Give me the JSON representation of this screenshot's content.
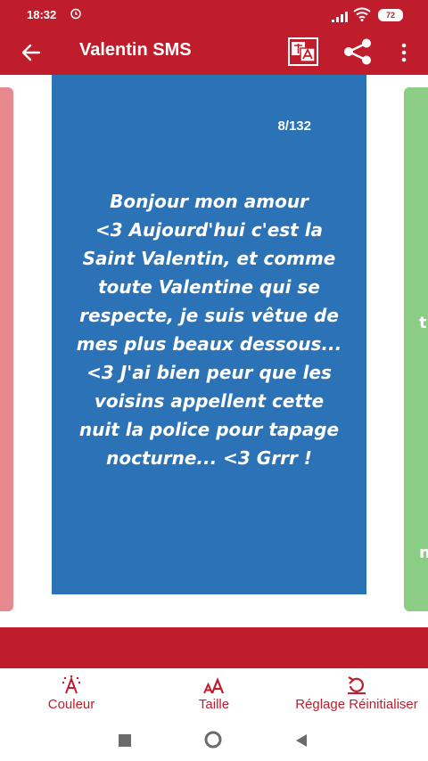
{
  "status": {
    "time": "18:32",
    "battery": "72"
  },
  "appbar": {
    "title": "Valentin SMS"
  },
  "card": {
    "counter": "8/132",
    "lines": [
      "Bonjour mon amour",
      "<3 Aujourd'hui c'est la",
      "Saint Valentin, et comme",
      "toute Valentine qui se",
      "respecte, je suis vêtue de",
      "mes plus beaux dessous...",
      "<3 J'ai bien peur que les",
      "voisins appellent cette",
      "nuit la police pour tapage",
      "nocturne... <3 Grrr !"
    ]
  },
  "side_right": {
    "fragments": [
      "t",
      "n"
    ]
  },
  "toolbar": {
    "couleur_label": "Couleur",
    "taille_label": "Taille",
    "reset_label": "Réglage Réinitialiser"
  },
  "colors": {
    "primary_red": "#c01d2c",
    "card_blue": "#2b73b6",
    "left_card_pink": "#e8898f",
    "right_card_green": "#8ccd86"
  },
  "icons": {
    "back": "arrow-left-icon",
    "translate": "translate-icon",
    "share": "share-icon",
    "more": "more-vertical-icon",
    "couleur": "color-palette-icon",
    "taille": "text-size-icon",
    "reset": "reset-icon"
  }
}
